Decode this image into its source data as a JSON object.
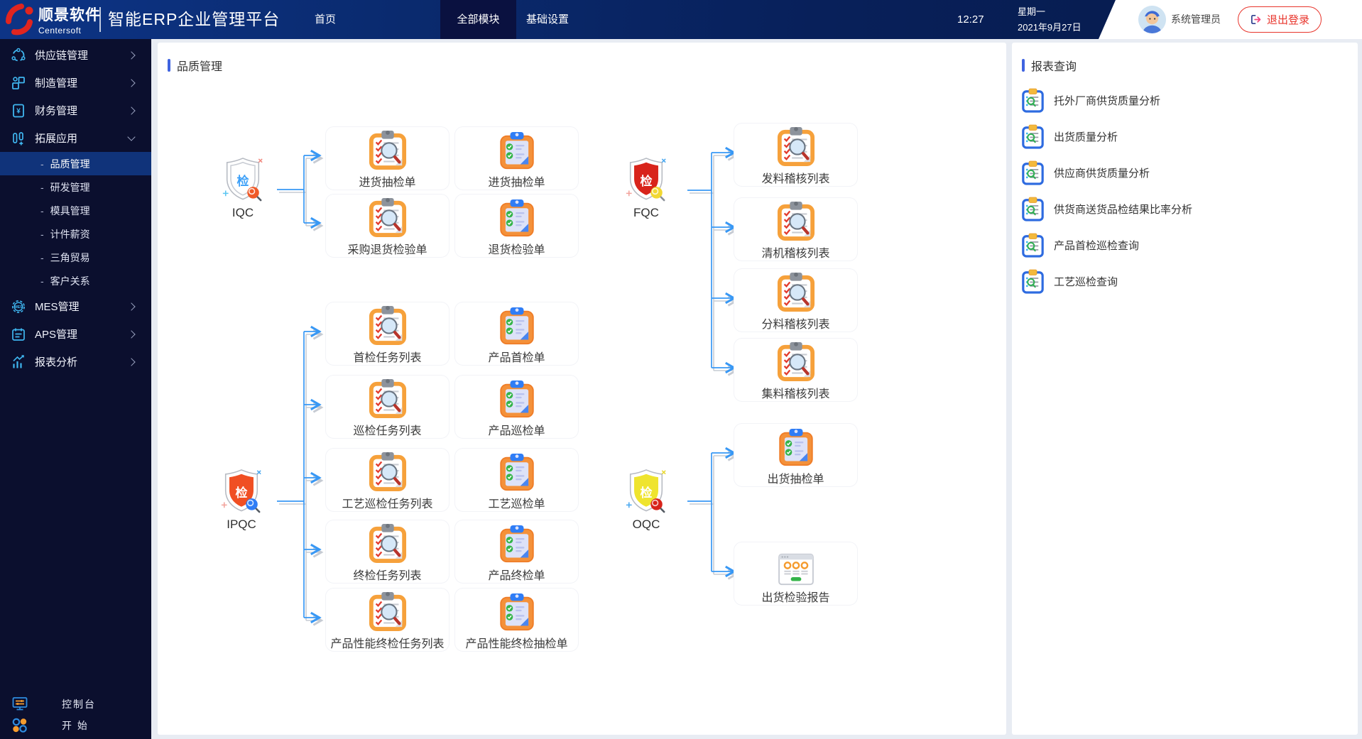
{
  "colors": {
    "brand_red": "#e0251f",
    "header_blue_start": "#0d3486",
    "header_blue_end": "#061a4a",
    "active_tab": "#0a1140",
    "sidebar_bg": "#0b0f2e",
    "sidebar_active": "#10337a",
    "sidebar_icon_cyan": "#3fb6f0",
    "section_accent": "#3f63e0",
    "arrow_blue": "#3898f5",
    "clipboard_orange": "#f6a13b",
    "clip_blue": "#2f7df6",
    "check_green": "#35b44a",
    "shield_red": "#d8241b",
    "shield_orange": "#f04f23",
    "shield_yellow": "#efe42e",
    "report_icon_blue": "#2e6be0",
    "logout_red": "#e8352c"
  },
  "header": {
    "logo_title": "顺景软件",
    "logo_subtitle": "Centersoft",
    "app_title": "智能ERP企业管理平台",
    "nav": [
      {
        "label": "首页",
        "active": false
      },
      {
        "label": "全部模块",
        "active": true
      },
      {
        "label": "基础设置",
        "active": false
      }
    ],
    "time": "12:27",
    "weekday": "星期一",
    "date": "2021年9月27日",
    "username": "系统管理员",
    "logout_label": "退出登录"
  },
  "sidebar": {
    "sub_bullet": "-",
    "icon_chars": {
      "finance": "¥",
      "mes": "MES"
    },
    "items": [
      {
        "label": "供应链管理",
        "type": "item",
        "icon": "supply-chain-icon",
        "chevron": "right"
      },
      {
        "label": "制造管理",
        "type": "item",
        "icon": "manufacturing-icon",
        "chevron": "right"
      },
      {
        "label": "财务管理",
        "type": "item",
        "icon": "finance-icon",
        "chevron": "right"
      },
      {
        "label": "拓展应用",
        "type": "item",
        "icon": "extensions-icon",
        "chevron": "down",
        "expanded": true
      },
      {
        "label": "品质管理",
        "type": "sub",
        "active": true
      },
      {
        "label": "研发管理",
        "type": "sub"
      },
      {
        "label": "模具管理",
        "type": "sub"
      },
      {
        "label": "计件薪资",
        "type": "sub"
      },
      {
        "label": "三角贸易",
        "type": "sub"
      },
      {
        "label": "客户关系",
        "type": "sub"
      },
      {
        "label": "MES管理",
        "type": "item",
        "icon": "mes-icon",
        "chevron": "right"
      },
      {
        "label": "APS管理",
        "type": "item",
        "icon": "aps-icon",
        "chevron": "right"
      },
      {
        "label": "报表分析",
        "type": "item",
        "icon": "report-analysis-icon",
        "chevron": "right"
      }
    ],
    "bottom": [
      {
        "label": "控制台",
        "icon": "console-icon"
      },
      {
        "label": "开 始",
        "icon": "start-icon"
      }
    ]
  },
  "main": {
    "title": "品质管理",
    "flow": {
      "shield_char": "检",
      "iqc": {
        "label": "IQC",
        "tasks": [
          {
            "label": "进货抽检单",
            "icon": "audit-clipboard-icon"
          },
          {
            "label": "采购退货检验单",
            "icon": "audit-clipboard-icon"
          }
        ],
        "forms": [
          {
            "label": "进货抽检单",
            "icon": "form-clipboard-icon"
          },
          {
            "label": "退货检验单",
            "icon": "form-clipboard-icon"
          }
        ]
      },
      "fqc": {
        "label": "FQC",
        "lists": [
          {
            "label": "发料稽核列表",
            "icon": "audit-clipboard-icon"
          },
          {
            "label": "清机稽核列表",
            "icon": "audit-clipboard-icon"
          },
          {
            "label": "分料稽核列表",
            "icon": "audit-clipboard-icon"
          },
          {
            "label": "集料稽核列表",
            "icon": "audit-clipboard-icon"
          }
        ]
      },
      "ipqc": {
        "label": "IPQC",
        "tasks": [
          {
            "label": "首检任务列表",
            "icon": "audit-clipboard-icon"
          },
          {
            "label": "巡检任务列表",
            "icon": "audit-clipboard-icon"
          },
          {
            "label": "工艺巡检任务列表",
            "icon": "audit-clipboard-icon"
          },
          {
            "label": "终检任务列表",
            "icon": "audit-clipboard-icon"
          },
          {
            "label": "产品性能终检任务列表",
            "icon": "audit-clipboard-icon"
          }
        ],
        "forms": [
          {
            "label": "产品首检单",
            "icon": "form-clipboard-icon"
          },
          {
            "label": "产品巡检单",
            "icon": "form-clipboard-icon"
          },
          {
            "label": "工艺巡检单",
            "icon": "form-clipboard-icon"
          },
          {
            "label": "产品终检单",
            "icon": "form-clipboard-icon"
          },
          {
            "label": "产品性能终检抽检单",
            "icon": "form-clipboard-icon"
          }
        ]
      },
      "oqc": {
        "label": "OQC",
        "items": [
          {
            "label": "出货抽检单",
            "icon": "form-clipboard-icon"
          },
          {
            "label": "出货检验报告",
            "icon": "report-window-icon"
          }
        ]
      }
    }
  },
  "reports": {
    "title": "报表查询",
    "icon": "report-query-icon",
    "items": [
      "托外厂商供货质量分析",
      "出货质量分析",
      "供应商供货质量分析",
      "供货商送货品检结果比率分析",
      "产品首检巡检查询",
      "工艺巡检查询"
    ]
  }
}
